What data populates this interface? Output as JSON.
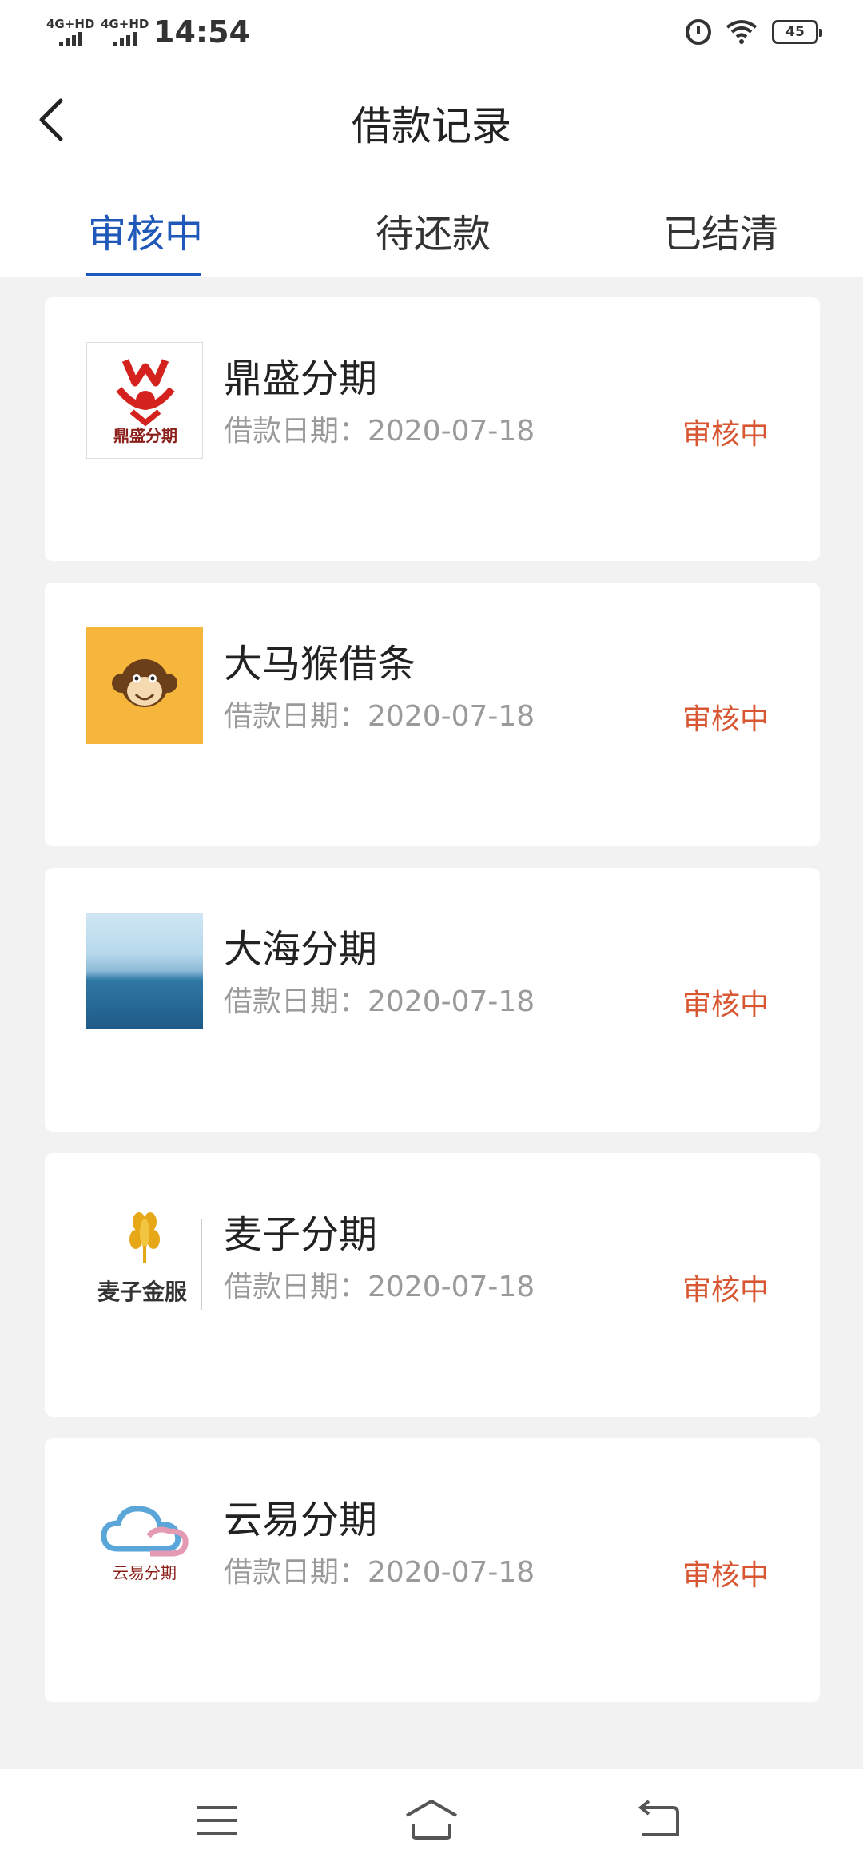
{
  "status_bar": {
    "network_1": "4G+HD",
    "network_2": "4G+HD",
    "time": "14:54",
    "battery": "45",
    "icons": [
      "signal-icon",
      "alarm-icon",
      "wifi-icon",
      "battery-icon"
    ]
  },
  "header": {
    "title": "借款记录",
    "back_icon": "chevron-left-icon"
  },
  "tabs": [
    {
      "label": "审核中",
      "active": true
    },
    {
      "label": "待还款",
      "active": false
    },
    {
      "label": "已结清",
      "active": false
    }
  ],
  "colors": {
    "accent": "#1f58b8",
    "status": "#d85632",
    "background": "#f2f2f2"
  },
  "loans": [
    {
      "name": "鼎盛分期",
      "date_label": "借款日期：2020-07-18",
      "status": "审核中",
      "logo": "dingsheng-logo",
      "logo_text": "鼎盛分期"
    },
    {
      "name": "大马猴借条",
      "date_label": "借款日期：2020-07-18",
      "status": "审核中",
      "logo": "monkey-logo"
    },
    {
      "name": "大海分期",
      "date_label": "借款日期：2020-07-18",
      "status": "审核中",
      "logo": "sea-logo"
    },
    {
      "name": "麦子分期",
      "date_label": "借款日期：2020-07-18",
      "status": "审核中",
      "logo": "wheat-logo",
      "logo_text": "麦子金服"
    },
    {
      "name": "云易分期",
      "date_label": "借款日期：2020-07-18",
      "status": "审核中",
      "logo": "cloud-logo",
      "logo_text": "云易分期"
    }
  ],
  "bottom_nav": {
    "icons": [
      "menu-icon",
      "home-icon",
      "back-icon"
    ]
  }
}
